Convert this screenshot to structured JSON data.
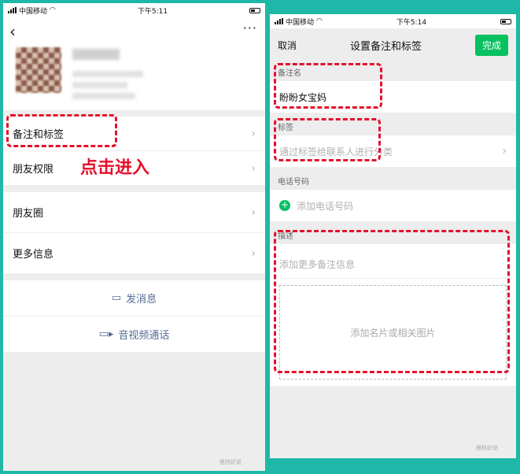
{
  "left": {
    "status": {
      "carrier": "中国移动",
      "time": "下午5:11"
    },
    "back_glyph": "‹",
    "more_glyph": "···",
    "menu": [
      {
        "label": "备注和标签"
      },
      {
        "label": "朋友权限"
      },
      {
        "label": "朋友圈"
      },
      {
        "label": "更多信息"
      }
    ],
    "actions": {
      "message": "发消息",
      "call": "音视频通话"
    },
    "callout": "点击进入",
    "watermark": "搭档好说"
  },
  "right": {
    "status": {
      "carrier": "中国移动",
      "time": "下午5:14"
    },
    "nav": {
      "cancel": "取消",
      "title": "设置备注和标签",
      "done": "完成"
    },
    "remark": {
      "label": "备注名",
      "value": "盼盼女宝妈"
    },
    "tags": {
      "label": "标签",
      "placeholder": "通过标签给联系人进行分类"
    },
    "phone": {
      "label": "电话号码",
      "placeholder": "添加电话号码"
    },
    "desc": {
      "label": "描述",
      "placeholder": "添加更多备注信息",
      "image_placeholder": "添加名片或相关图片"
    },
    "watermark": "搭档好说"
  },
  "colors": {
    "accent_red": "#e4112b",
    "wechat_green": "#07c160",
    "link_blue": "#576b95",
    "frame_teal": "#1fb8a8"
  },
  "icons": [
    "signal-icon",
    "wifi-icon",
    "battery-icon",
    "chevron-right-icon",
    "chat-bubble-icon",
    "video-icon",
    "plus-icon"
  ]
}
